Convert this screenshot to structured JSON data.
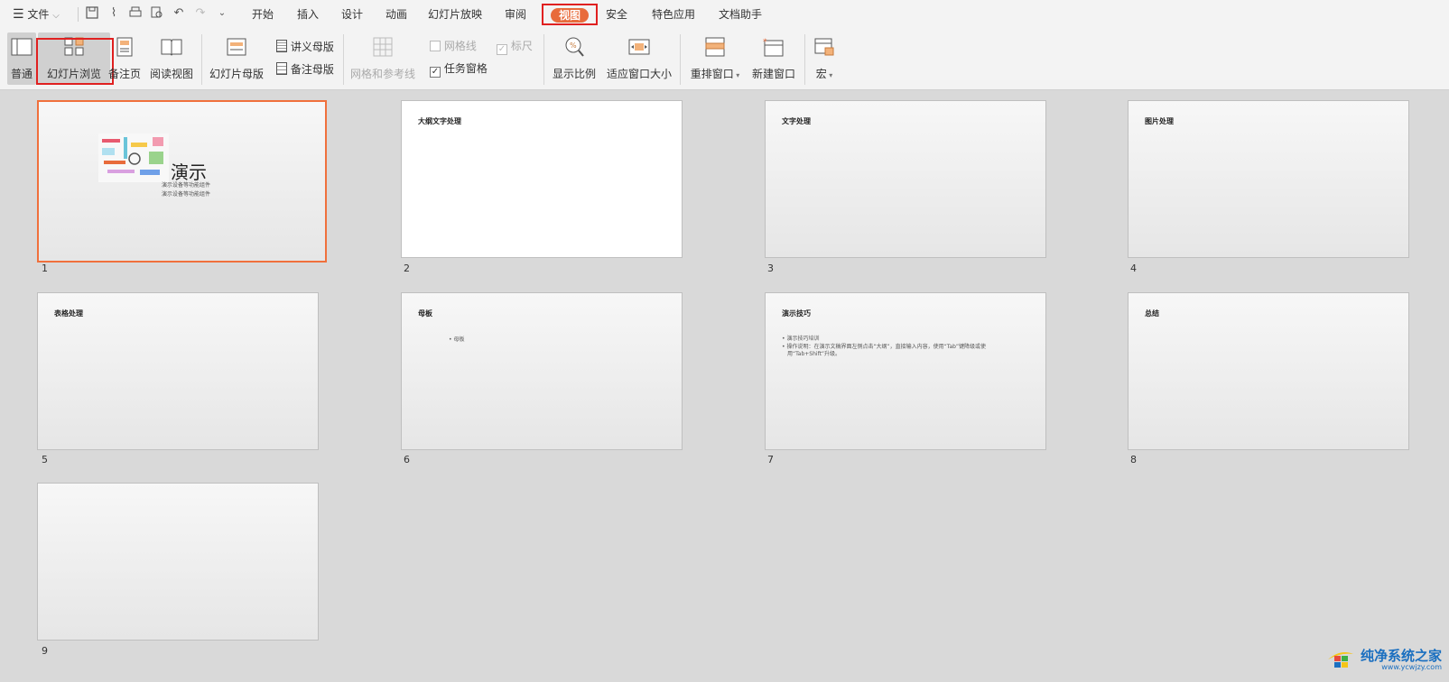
{
  "menubar": {
    "file_label": "文件",
    "tabs": [
      "开始",
      "插入",
      "设计",
      "动画",
      "幻灯片放映",
      "审阅",
      "视图",
      "安全",
      "特色应用",
      "文档助手"
    ],
    "active_tab": "视图"
  },
  "ribbon": {
    "normal": "普通",
    "slide_sorter": "幻灯片浏览",
    "notes_page": "备注页",
    "reading_view": "阅读视图",
    "slide_master": "幻灯片母版",
    "handout_master": "讲义母版",
    "notes_master": "备注母版",
    "grid_guides": "网格和参考线",
    "gridlines": "网格线",
    "ruler": "标尺",
    "task_pane": "任务窗格",
    "zoom": "显示比例",
    "fit_window": "适应窗口大小",
    "arrange_window": "重排窗口",
    "new_window": "新建窗口",
    "macro": "宏"
  },
  "slides": [
    {
      "num": "1",
      "title": "",
      "main_text": "演示",
      "sub1": "演示设备等功能组件",
      "sub2": "演示设备等功能组件"
    },
    {
      "num": "2",
      "title": "大纲文字处理"
    },
    {
      "num": "3",
      "title": "文字处理"
    },
    {
      "num": "4",
      "title": "图片处理"
    },
    {
      "num": "5",
      "title": "表格处理"
    },
    {
      "num": "6",
      "title": "母板",
      "bullet": "• 母板"
    },
    {
      "num": "7",
      "title": "演示技巧",
      "bullet1": "• 演示技巧培训",
      "bullet2": "• 操作说明：在演示文稿界面左侧点击“大纲”，直接输入内容，使用“Tab”键降级或使",
      "bullet3": "用“Tab+Shift”升级。"
    },
    {
      "num": "8",
      "title": "总结"
    },
    {
      "num": "9",
      "title": ""
    }
  ],
  "watermark": {
    "title": "纯净系统之家",
    "url": "www.ycwjzy.com"
  },
  "colors": {
    "accent": "#e86b3b",
    "highlight_box": "#e02020",
    "selected_slide_border": "#f0703c"
  }
}
